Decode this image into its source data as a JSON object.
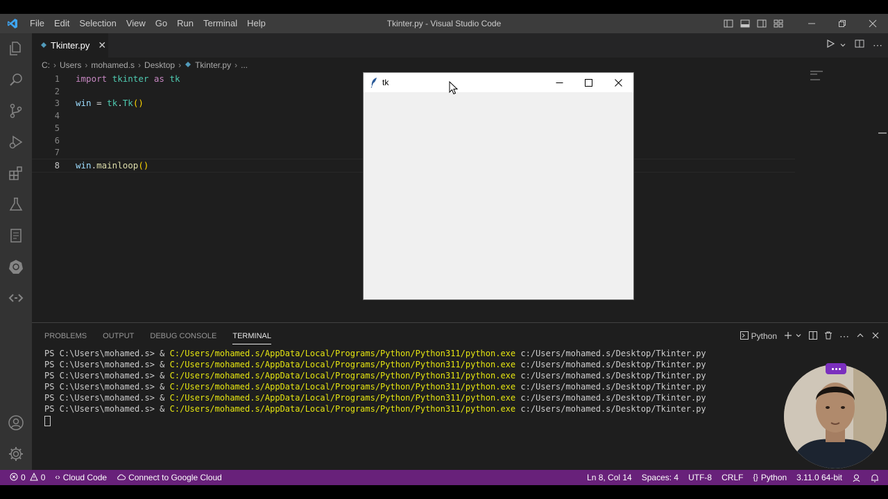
{
  "window": {
    "title": "Tkinter.py - Visual Studio Code"
  },
  "menu": [
    "File",
    "Edit",
    "Selection",
    "View",
    "Go",
    "Run",
    "Terminal",
    "Help"
  ],
  "tab": {
    "label": "Tkinter.py",
    "close": "✕"
  },
  "breadcrumb": [
    "C:",
    "Users",
    "mohamed.s",
    "Desktop",
    "Tkinter.py",
    "..."
  ],
  "editor": {
    "line_numbers": [
      "1",
      "2",
      "3",
      "4",
      "5",
      "6",
      "7",
      "8"
    ],
    "active_line": "8",
    "lines": {
      "l1": {
        "kw": "import",
        "mod": "tkinter",
        "as": "as",
        "alias": "tk"
      },
      "l3": {
        "var": "win",
        "eq": "=",
        "ns": "tk",
        "dot": ".",
        "fn": "Tk",
        "paren": "()"
      },
      "l8": {
        "var": "win",
        "dot": ".",
        "fn": "mainloop",
        "paren": "()"
      }
    }
  },
  "tk_window": {
    "title": "tk"
  },
  "panel": {
    "tabs": [
      "PROBLEMS",
      "OUTPUT",
      "DEBUG CONSOLE",
      "TERMINAL"
    ],
    "active_tab": "TERMINAL",
    "shell_label": "Python"
  },
  "terminal": {
    "prompt": "PS C:\\Users\\mohamed.s> & ",
    "exe": "C:/Users/mohamed.s/AppData/Local/Programs/Python/Python311/python.exe",
    "arg": " c:/Users/mohamed.s/Desktop/Tkinter.py",
    "line_count": 6
  },
  "status": {
    "errors": "0",
    "warnings": "0",
    "cloud_code": "Cloud Code",
    "connect": "Connect to Google Cloud",
    "position": "Ln 8, Col 14",
    "spaces": "Spaces: 4",
    "encoding": "UTF-8",
    "eol": "CRLF",
    "language": "Python",
    "interpreter": "3.11.0 64-bit"
  },
  "colors": {
    "status_bar": "#68217a",
    "accent": "#007acc",
    "editor_bg": "#1e1e1e"
  }
}
